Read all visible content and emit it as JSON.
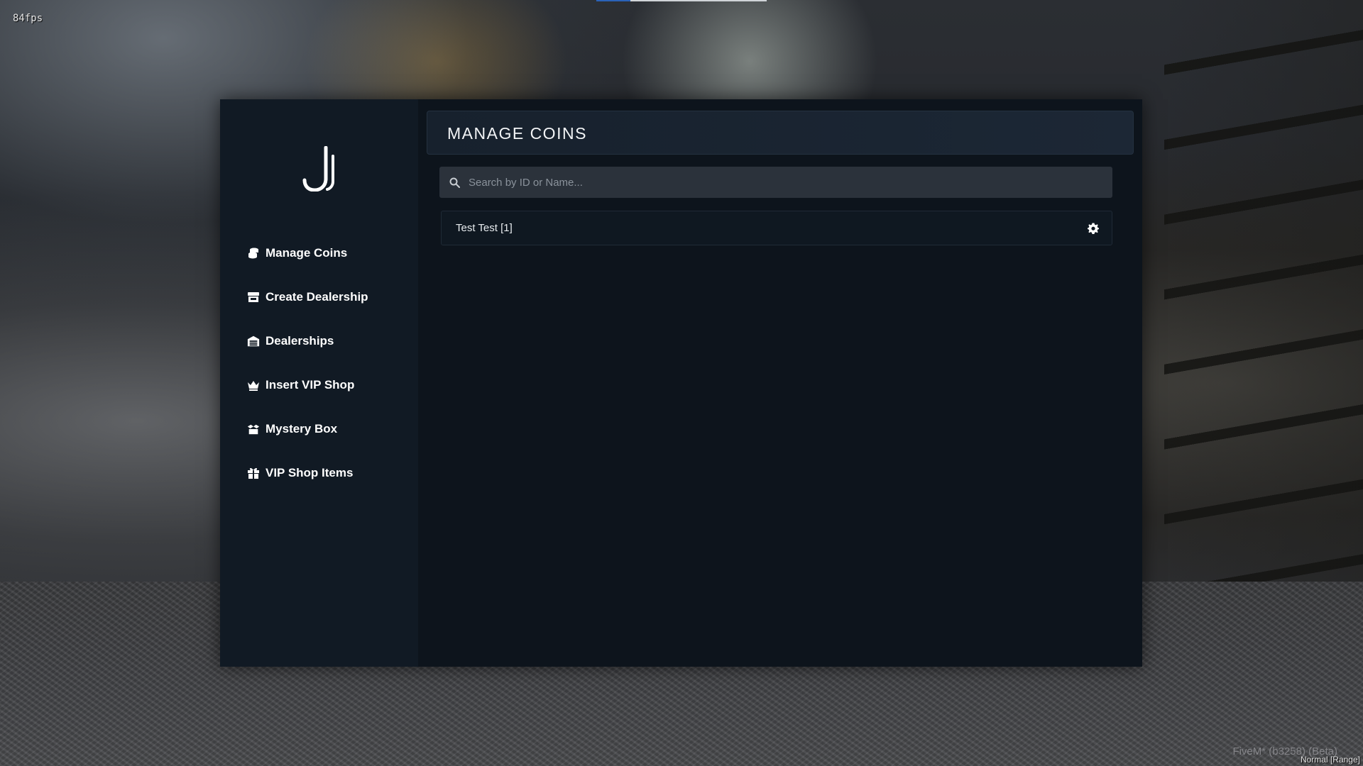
{
  "overlay": {
    "fps": "84fps",
    "watermark": "FiveM* (b3258) (Beta)",
    "mode": "Normal [Range]"
  },
  "sidebar": {
    "logo_icon": "j-logo",
    "items": [
      {
        "label": "Manage Coins",
        "icon": "coins-icon",
        "active": true
      },
      {
        "label": "Create Dealership",
        "icon": "store-icon"
      },
      {
        "label": "Dealerships",
        "icon": "warehouse-icon"
      },
      {
        "label": "Insert VIP Shop",
        "icon": "crown-icon"
      },
      {
        "label": "Mystery Box",
        "icon": "box-open-icon"
      },
      {
        "label": "VIP Shop Items",
        "icon": "gift-icon"
      }
    ]
  },
  "main": {
    "title": "MANAGE COINS",
    "search": {
      "placeholder": "Search by ID or Name...",
      "value": ""
    },
    "players": [
      {
        "name": "Test Test [1]"
      }
    ]
  },
  "colors": {
    "panel_bg": "#0d141c",
    "sidebar_bg": "#111a24",
    "title_bar": "#1c2735",
    "search_bg": "#2b323b",
    "accent_bar": "#2a62b8"
  }
}
